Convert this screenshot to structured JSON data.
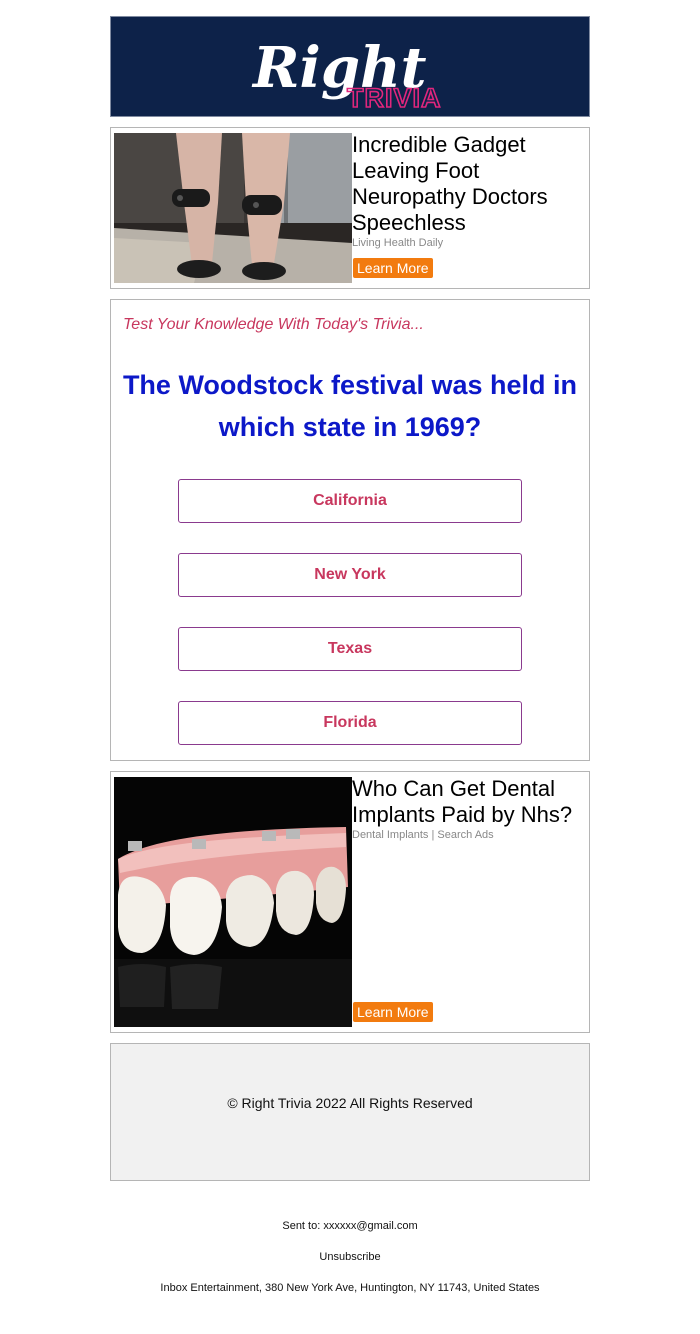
{
  "header": {
    "logo_main": "Right",
    "logo_sub": "TRIVIA"
  },
  "ads": [
    {
      "title": "Incredible Gadget Leaving Foot Neuropathy Doctors Speechless",
      "source": "Living Health Daily",
      "cta": "Learn More"
    },
    {
      "title": "Who Can Get Dental Implants Paid by Nhs?",
      "source": "Dental Implants | Search Ads",
      "cta": "Learn More"
    }
  ],
  "trivia": {
    "intro": "Test Your Knowledge With Today's Trivia...",
    "question": "The Woodstock festival was held in which state in 1969?",
    "answers": [
      "California",
      "New York",
      "Texas",
      "Florida"
    ]
  },
  "footer": {
    "copyright": "© Right Trivia 2022 All Rights Reserved",
    "sent_to": "Sent to: xxxxxx@gmail.com",
    "unsubscribe": "Unsubscribe",
    "address": "Inbox Entertainment, 380 New York Ave, Huntington, NY 11743, United States"
  },
  "colors": {
    "header_bg": "#0d2249",
    "logo_pink": "#e0267d",
    "question_blue": "#0c18c8",
    "answer_pink": "#c8375e",
    "cta_orange": "#f27b0f"
  }
}
